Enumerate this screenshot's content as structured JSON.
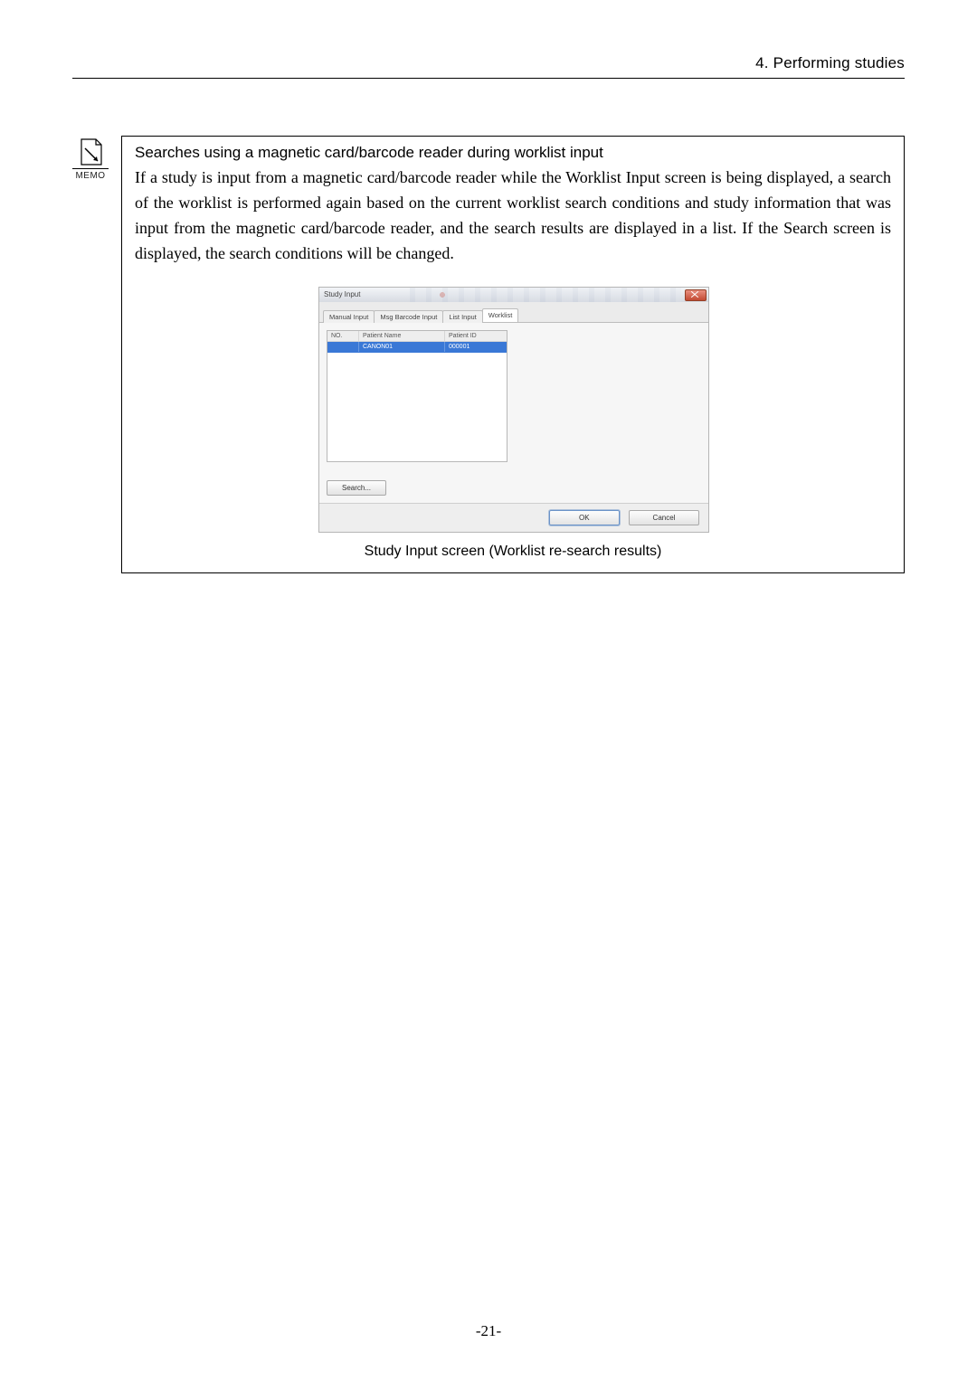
{
  "header": {
    "section": "4. Performing studies"
  },
  "memo": {
    "icon_label": "MEMO",
    "title": "Searches using a magnetic card/barcode reader during worklist input",
    "body": "If a study is input from a magnetic card/barcode reader while the Worklist Input screen is being displayed, a search of the worklist is performed again based on the current worklist search conditions and study information that was input from the magnetic card/barcode reader, and the search results are displayed in a list. If the Search screen is displayed, the search conditions will be changed."
  },
  "screenshot": {
    "window_title": "Study Input",
    "tabs": [
      {
        "label": "Manual Input",
        "active": false
      },
      {
        "label": "Msg Barcode Input",
        "active": false
      },
      {
        "label": "List Input",
        "active": false
      },
      {
        "label": "Worklist",
        "active": true
      }
    ],
    "list": {
      "columns": {
        "no": "NO.",
        "name": "Patient Name",
        "id": "Patient ID"
      },
      "rows": [
        {
          "no": "",
          "name": "CANON01",
          "id": "000001",
          "selected": true
        }
      ]
    },
    "search_button": "Search...",
    "ok_button": "OK",
    "cancel_button": "Cancel",
    "caption": "Study Input screen (Worklist re-search results)"
  },
  "page_number": "-21-"
}
